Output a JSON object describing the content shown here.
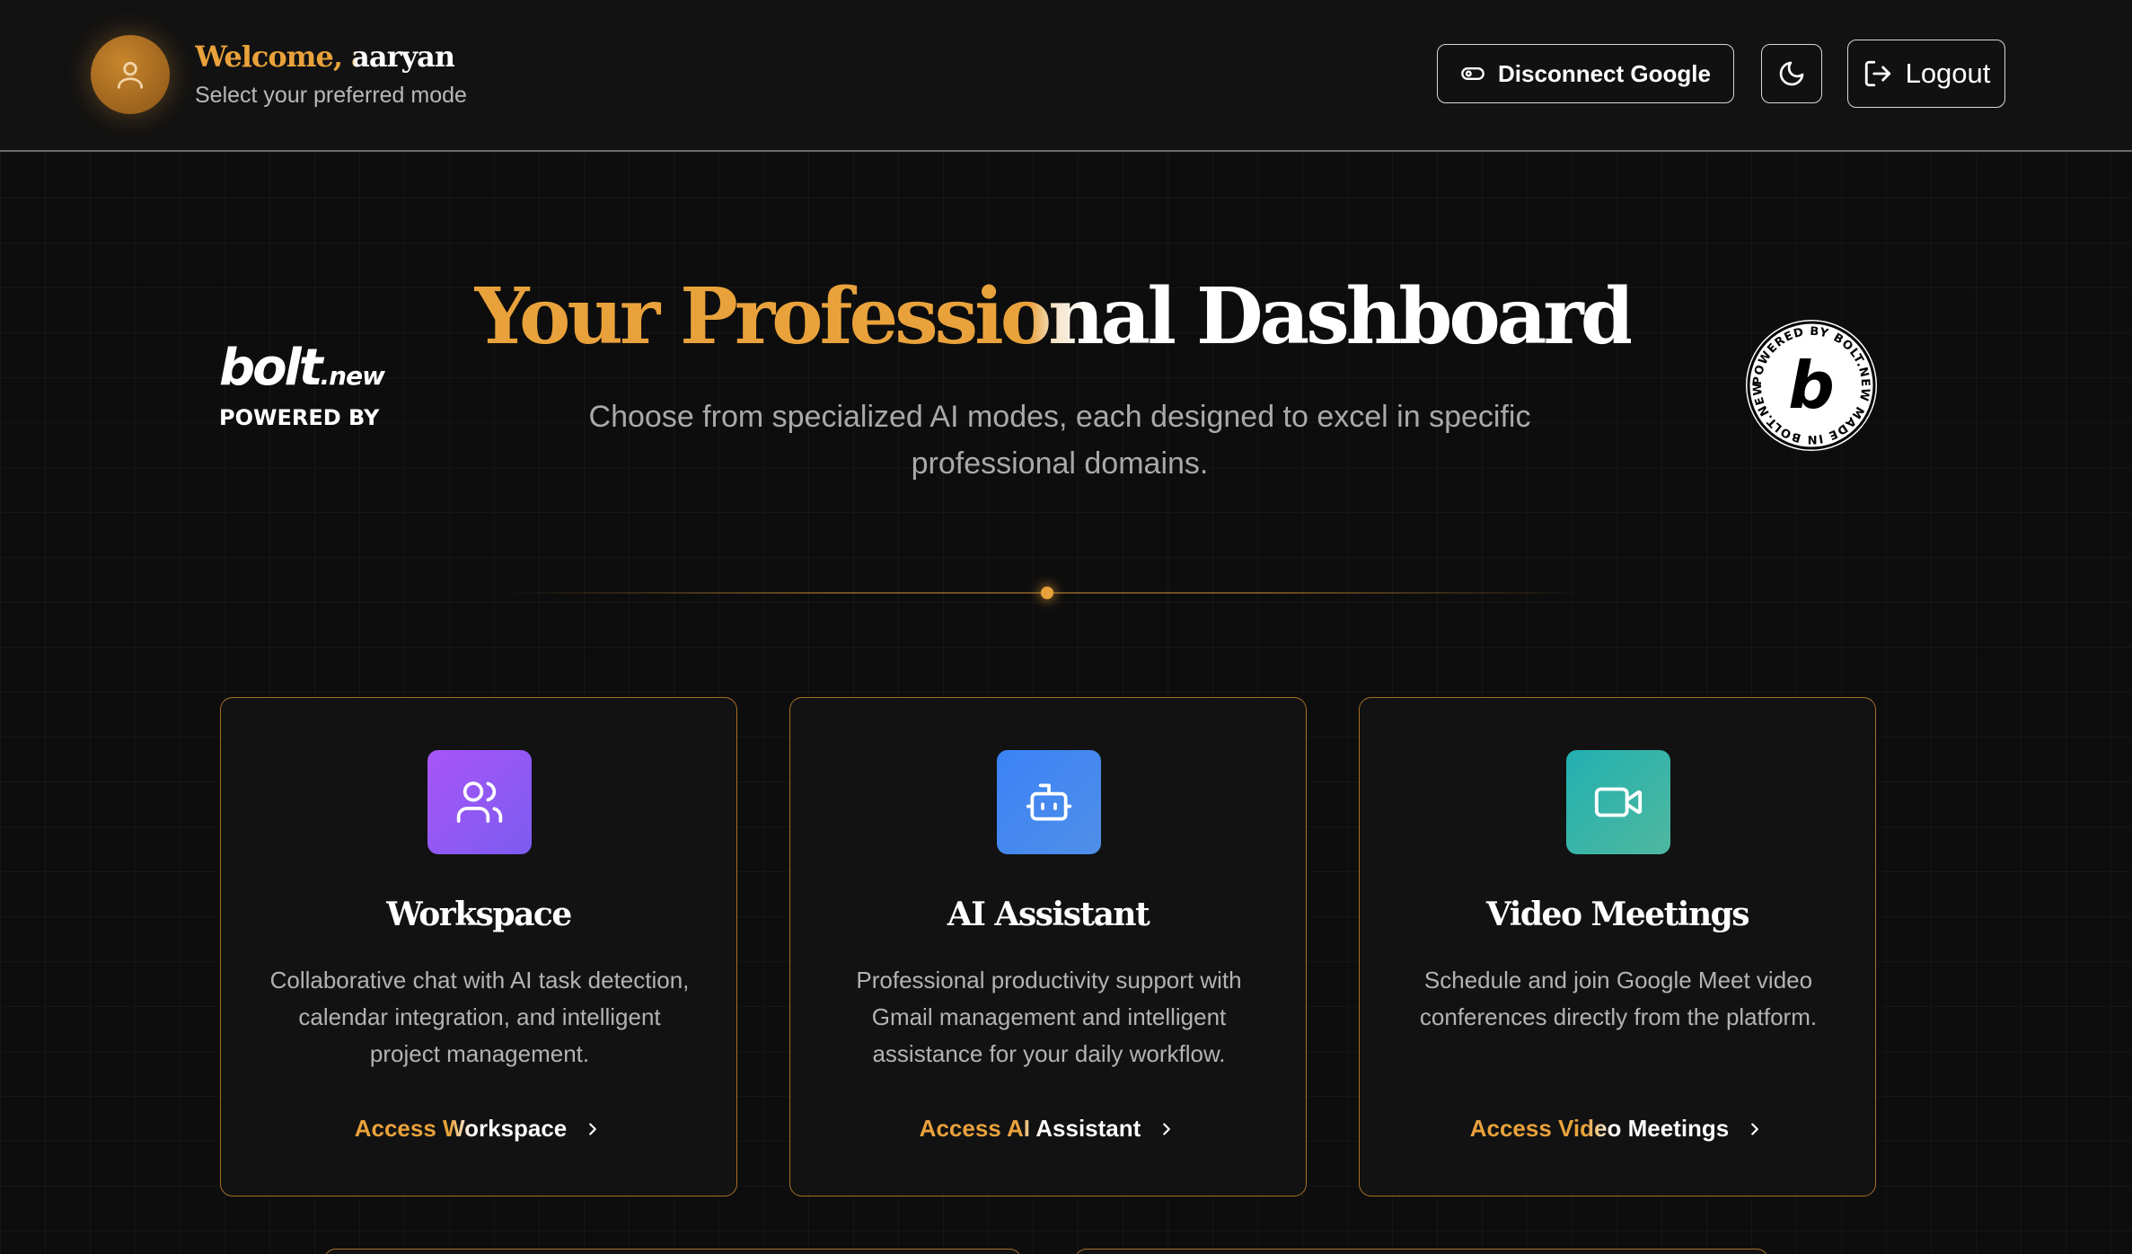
{
  "header": {
    "welcome": "Welcome, aaryan",
    "subtitle": "Select your preferred mode",
    "disconnect_label": "Disconnect Google",
    "logout_label": "Logout"
  },
  "hero": {
    "title": "Your Professional Dashboard",
    "subtitle": "Choose from specialized AI modes, each designed to excel in specific professional domains."
  },
  "branding": {
    "logo_text": "bolt",
    "logo_suffix": ".new",
    "powered_by": "POWERED BY",
    "badge_ring_text": "POWERED BY BOLT.NEW MADE IN BOLT.NEW"
  },
  "cards": [
    {
      "icon": "users-icon",
      "title": "Workspace",
      "description": "Collaborative chat with AI task detection, calendar integration, and intelligent project management.",
      "link": "Access Workspace"
    },
    {
      "icon": "bot-icon",
      "title": "AI Assistant",
      "description": "Professional productivity support with Gmail management and intelligent assistance for your daily workflow.",
      "link": "Access AI Assistant"
    },
    {
      "icon": "video-icon",
      "title": "Video Meetings",
      "description": "Schedule and join Google Meet video conferences directly from the platform.",
      "link": "Access Video Meetings"
    }
  ],
  "colors": {
    "accent": "#e9a23b",
    "background": "#0d0d0d",
    "card_border": "#a86e2a"
  }
}
